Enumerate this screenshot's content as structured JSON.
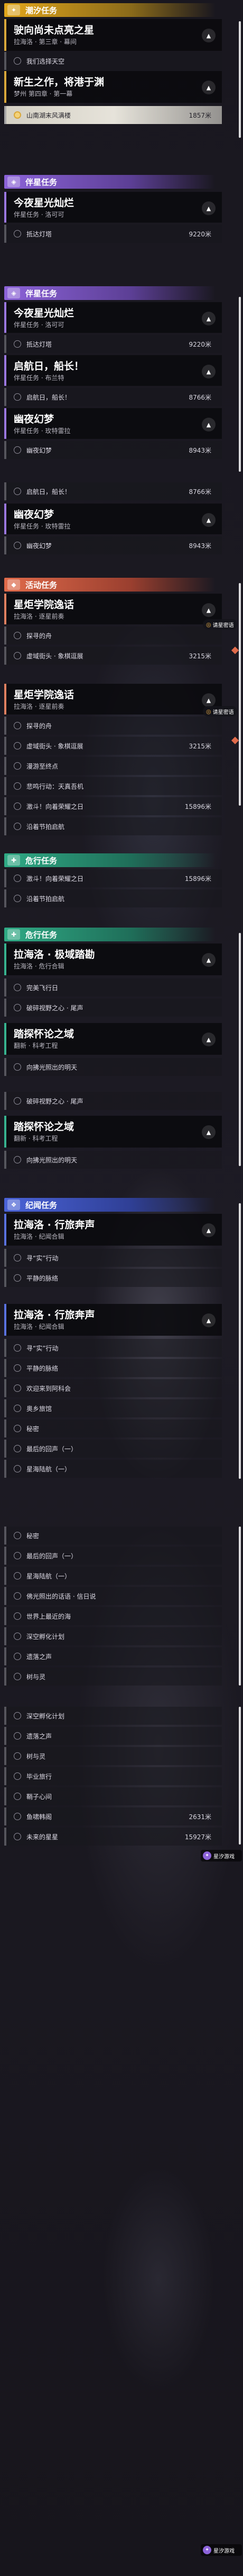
{
  "categories": {
    "main": "潮汐任务",
    "companion": "伴星任务",
    "event": "活动任务",
    "daily": "危行任务",
    "side": "纪闻任务"
  },
  "main_tasks": [
    {
      "title": "驶向尚未点亮之星",
      "subtitle": "拉海洛 · 第三章 · 幕间"
    },
    {
      "title": "新生之作，将港于渊",
      "subtitle": "梦州 第四章 · 第一幕"
    }
  ],
  "main_subs": [
    {
      "label": "我们选择天空",
      "dist": ""
    },
    {
      "label": "山南湖末风满楼",
      "dist": "1857米"
    }
  ],
  "companion_tasks": [
    {
      "title": "今夜星光灿烂",
      "subtitle": "伴星任务 · 洛可可"
    },
    {
      "title": "启航日，船长！",
      "subtitle": "伴星任务 · 布兰特"
    },
    {
      "title": "幽夜幻梦",
      "subtitle": "伴星任务 · 玫特雷拉"
    }
  ],
  "companion_subs": [
    {
      "label": "抵达灯塔",
      "dist": "9220米"
    },
    {
      "label": "启航日，船长！",
      "dist": "8766米"
    },
    {
      "label": "幽夜幻梦",
      "dist": "8943米"
    }
  ],
  "event_tasks": [
    {
      "title": "星炬学院逸话",
      "subtitle": "拉海洛 · 逐星前奏"
    }
  ],
  "event_subs": [
    {
      "label": "探寻的舟",
      "dist": ""
    },
    {
      "label": "虚域街头 · 象棋逗展",
      "dist": "3215米"
    },
    {
      "label": "漫游至终点",
      "dist": ""
    },
    {
      "label": "悲鸣行动：天真吾机",
      "dist": ""
    },
    {
      "label": "激斗！向着荣耀之日",
      "dist": "15896米"
    },
    {
      "label": "沿着节拍启航",
      "dist": ""
    }
  ],
  "badge_text": "请星密语",
  "daily_tasks": [
    {
      "title": "拉海洛 · 极域踏勘",
      "subtitle": "拉海洛 · 危行合辑"
    },
    {
      "title": "踏探怀论之域",
      "subtitle": "翻新 · 科考工程"
    }
  ],
  "daily_subs": [
    {
      "label": "完美飞行日",
      "dist": ""
    },
    {
      "label": "破碎视野之心 · 尾声",
      "dist": ""
    },
    {
      "label": "向拂光照出的明天",
      "dist": ""
    }
  ],
  "side_tasks": [
    {
      "title": "拉海洛 · 行旅奔声",
      "subtitle": "拉海洛 · 纪闻合辑"
    }
  ],
  "side_subs": [
    {
      "label": "寻“实”行动",
      "dist": ""
    },
    {
      "label": "平静的脉络",
      "dist": ""
    },
    {
      "label": "欢迎来到阿科会",
      "dist": ""
    },
    {
      "label": "奥乡旅馆",
      "dist": ""
    },
    {
      "label": "秘密",
      "dist": ""
    },
    {
      "label": "最后的回声（一）",
      "dist": ""
    },
    {
      "label": "星海陆航（一）",
      "dist": ""
    },
    {
      "label": "佛光照出的话语 · 信日说",
      "dist": ""
    },
    {
      "label": "世界上最近的海",
      "dist": ""
    },
    {
      "label": "深空孵化计划",
      "dist": ""
    },
    {
      "label": "遗落之声",
      "dist": ""
    },
    {
      "label": "树与灵",
      "dist": ""
    },
    {
      "label": "毕业旅行",
      "dist": ""
    },
    {
      "label": "鞘子心间",
      "dist": ""
    },
    {
      "label": "鱼啸韩阁",
      "dist": "2631米"
    },
    {
      "label": "未来的星星",
      "dist": "15927米"
    }
  ],
  "logo_text": "星汐游戏"
}
